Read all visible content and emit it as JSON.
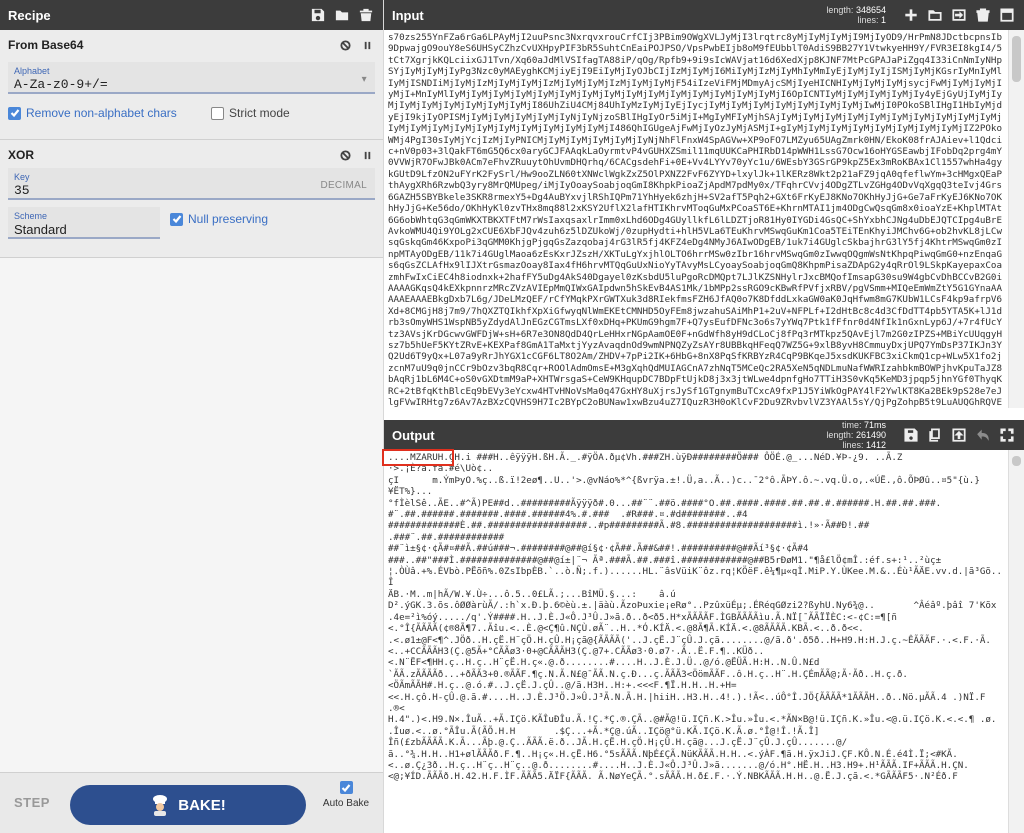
{
  "recipe": {
    "title": "Recipe",
    "operations": [
      {
        "name": "From Base64",
        "alphabet_label": "Alphabet",
        "alphabet_value": "A-Za-z0-9+/=",
        "remove_label": "Remove non-alphabet chars",
        "strict_label": "Strict mode"
      },
      {
        "name": "XOR",
        "key_label": "Key",
        "key_value": "35",
        "key_format": "DECIMAL",
        "scheme_label": "Scheme",
        "scheme_value": "Standard",
        "null_label": "Null preserving"
      }
    ],
    "step_label": "STEP",
    "bake_label": "BAKE!",
    "autobake_label": "Auto Bake"
  },
  "input": {
    "title": "Input",
    "length_label": "length:",
    "length_value": "348654",
    "lines_label": "lines:",
    "lines_value": "1",
    "text": "s70zs255YnFZa6rGa6LPAyMjI2uuPsnc3NxrqvxrouCrfCIj3PBim9OWgXVLJyMjI3lrqtrc8yMjIyMjIyMjI9MjIyOD9/HrPmN8JDctbcpnsIb9DpwajgO9ouY8eS6UHSyCZhzCvUXHpyPIF3bR5SuhtCnEaiPOJPSO/VpsPwbEIjb8oM9fEUbblT0AdiS9BB27Y1VtwkyeHH9Y/FVR3EI8kgI4/5tCt7XgrjkKQLciixGJ1Tvn/Xq60aJdMlVSIfagTA88iP/qOg/Rpfb9+9i9sIcWAVjat16d6XedXjp8KJNF7MtPcGPAJaPiZgq4I33iCnNmIyNHpSYjIyMjIyMjIyPg3Nzc0yMAEyghKCMjiyEjI9EiIyMjIyOJbCIjIzMjIyMjI6MiIyMjIzMjIyMhIyMmIyEjIyMjIyIjISMjIyMjKGsrIyMnIyMlIyMjISNDIiMjIyMjIzMjIyMjIyMjIzMjIyMjIyMjIzMjIyMjIyMjF54iIzeViFMjMDmyAjcSMjIyeHICNHIyMjIyMjIyMjsycjFwMjIyMjIyMjIyMjI+MnIyMlIyMjIyMjIyMjIyMjIyMjIyMjIyMjIyMjIyMjIyMjIyMjIyMjIyMjIyMjIyMjI6OpICNTIyMjIyMjIyMjIyMjIy4yEjGyUjIyMjIyMjIyMjIyMjIyMjIyMjIyMjIyMjI86UhZiU4CMj84UhIyMzIyMjIyEjIycjIyMjIyMjIyMjIyMjIyMjIyMjIyMjIwMjI0POkoSBlIHgI1HbIyMjdyEjI9kjIyOPISMjIyMjIyMjIyMjIyMjIyNjIyNjzoSBlIHgIyOr5iMjI+MgIyMFIyMjhSAjIyMjIyMjIyMjIyMjIyMjIyMjIyMjIyMjIyMjIyMjIyMjIyMjIyMjIyMjIyMjIyMjIyMjIyMjIyMjIyMjI486QhIGUgeAjFwMjIyOzJyMjASMjI+gIyMjIyMjIyMjIyMjIyMjIyMjIyMjIyMjIZ2POkoWMj4PgI30sIyMjYcjIzMjIyPNICMjIyMjIyMjIyMjIyMjIyNjNhFlFnxW4SpAGVw+XP9oFO7LMZyu65UAgZmrk0HN/EkoK08frAJAiev+l1Qdcic+nV0p03+3lQakFT6mG5Q6cx0aryGCJFAAqkLaOyrmtvP4vGUHXZSmil11mqUUKCaPHIRbD14pWWH1LssG7Ocw16oHYGSEawbjIFobDq2prg4mY0VVWjR7OFwJBk0ACm7eFhvZRuuytOhUvmDHQrhq/6CACgsdehFi+0E+Vv4LYYv70yYc1u/6WEsbY3GSrGP9kpZ5Ex3mRoKBAx1Cl1557whHa4gykGUtD9LfzON2uFYrK2FySrl/Hw9ooZLN60tXNWclWgkZxZ5OlPXNZ2FvF6ZYYD+lxylJk+1lKERz8Wkt2p21aFZ9jqA0qfeflwYm+3cHMgxQEaPthAygXRh6RzwbQ3yry8MrQMUpeg/iMjIyOoaySoabjoqGmI8KhpkPioaZjApdM7pdMy0x/TFqhrCVvj4ODgZTLvZGHg4ODvVqXgqQ3teIvj4Grs6GAZH5SBYBkele3SKR8rmexY5+Dg4AuBYxvjlRShIQPm71YhHyek6zhjH+SV2afT5Pqh2+GXt6FrKyEJ8KNo7OKhHyJjG+Ge7aFrKyEJ6KNo7OKhHyJjG+Ke56do/OKhHyKl0zvTHx8mq88l2xKSY2UflX2lafHTIKhrvMToqGuMxPCoaST6E+KhrnMTAI1jm4ODgCwQsqGm8x0ioaYzE+KhplMTAt6G6obWhtqG3qGmWKXTBKXTFtM7rWsIaxqsaxlrImm0xLhd6ODg4GUyllkfL6lLDZTjoR81Hy0IYGDi4GsQC+ShYxbhCJNg4uDbEJQTCIpg4uBrEAvkoWMU4Qi9YOLg2xCUE6XbFJQv4zuh6z5lDZUkoWj/0zupHydti+hlH5VLa6TEuKhrvMSwqGuKm1Coa5TEiTEnKhyiJMChv6G+ob2hvKL8jLCwsqGskqGm46KxpoPi3qGMM0KhjgPjgqGsZazqobaj4rG3lR5fj4KFZ4eDg4NMyJ6AIwODgEB/1uk7i4GUglcSkbajhrG3lY5fj4KhtrMSwqGm0zInpMTAyODgEB/11k7i4GUglMaoa6zEsKxrJZszH/XKTuLgYxjhlOLTO6hrrMSw0zIbr16hrvMSwqGm0zIwwqOQgmWsNtKhpqPiwqGmG0+nzEnqaGs6qGsZCLAfHx9lIJXtrGsmazOoay8Iax4fH6hrvMTQqGuUxNioYyTAvyMsLCyoaySoabjoqGmQ8KhpmPisaZDApG2y4qRrOl9LSkpKayepaxCoazmhFwIxCiEC4h8iodnxk+2hafFY5uDg4AkS40Dgayel0zKsbdU5luPgoRcDMQpt7LJlKZSNHylrJxcBMQofImsapG30su9W4gbCvDhBCCvB2G0iAAAAGKqsQ4kEXkpnnrzMRcZVzAVIEpMmQIWxGAIpdwn5hSkEvB4AS1Mk/1bMPp2ssRGO9cKBwRfPVfjxRBV/pgVSmm+MIQeEmWmZtY5G1GYnaAAAAAEAAAEBkgDxb7L6g/JDeLMzQEF/rCfYMqkPXrGWTXuk3d8RIekfmsFZH6JfAQ0o7K8DfddLxkaGW0aK0JqHfwm8mG7KUbW1LCsF4kp9afrpV6Xd+8CMGjH8j7m9/7hQXZTQIkhfXpXiGfwyqNlWmEKEtCMNHD5OyFEm8jwzahuSAiMhP1+2uV+NFPLf+I2dHtBc8c4d3CfDdTT4pb5YTA5K+lJ1drb3sOmyWHS1WspNB5yZdydAlJnEGzCGTmsLXf0xDHq+PKUmG9hgm7F+Q7ysEufDFNc3o6s7yYWq7Ptk1fFfnr0d4NfIk1nGxnLyp6J/+7r4fUcYtz3AVsjKrDGcwvGWFDjW+sH+6R7e3ON8QdD4QrLeHHxrNGpAamOE0F+nGdWfh8yH9dCLoCj8fPq3rMTkpz5QAvEjl7m2G0zIPZS+MBiYcUUqgyHsz7b5hUeF5KYtZRvE+KEXPaf8GmA1TaMxtjYyzAvaqdnOd9wmNPNQZyZsAYr8UBBkqHFeqQ7WZ5G+9xlB8yvH8CmmuyDxjUPQ7YmDsP37IKJn3YQ2Ud6T9yQx+L07a9yRrJhYGX1cCGF6LT8O2Am/ZHDV+7pPi2IK+6HbG+8nX8PqSfKRBYzR4CqP9BKqeJ5xsdKUKFBC3xiCkmQ1cp+WLw5X1fo2jzcnM7uU9q0jnCCr9bOzv3bqR8Cqr+ROOlAdmOmsE+M3gXqhQdMUIAGCnA7zhNqT5MCeQc2RA5XeN5qNDLmuNafWWRIzahbkmBOWPjhvKpuTaJZ8bAqRj1bL6M4C+oS0vGXDtmM9aP+XHTWrsgaS+CeW9KHqupDC7BDpFtUjkD8j3x3jtWLwe4dpnfgHo7TTiH3S0vKq5KeMD3jpqp5jhnYGf0ThyqKRC+2tBfqKthBlcEq9bEVy3eYcxw4HTvHNoVsMa0q47GxHY8uXjrsJySf1GTgnymBuTCxcA9fxP1J5YiWkOgPAY4lF2YwlKT8Ka2BEk9pS28e7eJlgFVwIRHtg7z6Av7AzBXzCQVHS9H7Ic2BYpC2oBUNaw1xwBzu4uZ7IQuzR3H0oKlCvF2Du9ZRvbvlVZ3YAAl5sY/QjPgZohpB5t9LuAUQGhRQVEF5B3s9+LfXVxIsQjYwQ+vMKP5EqKeE7TStv0WkE2qC1T+UHRv6HdhpfNR2aWu1JCVSh+QIAiRCbUdR7M3XVLWTxKSL7Cxiwu1JkNqmDwvyEaeTqCr/7pvKbFcw9sX+F47L1YDe1CZM0JSL8CmrGjEeJ3sqwm5iRjsJwJbzZHCoCy"
  },
  "output": {
    "title": "Output",
    "time_label": "time:",
    "time_value": "71ms",
    "length_label": "length:",
    "length_value": "261490",
    "lines_label": "lines:",
    "lines_value": "1412",
    "text": "....MZARUH.ÇH.i ###H..êÿÿÿH.ßH.Ã._.#ÿÖA.ðµ¢Vh.###ZH.ùÿÐ########Ö### ÔÖÉ.@_...NéD.¥Þ-¿9. ..Ã.Z\n·>.¡È?ã.fã.#é\\Uò¢..\nçI      m.ÝmÞyO.%ç..ß.ï!2eø¶..U..'>.@vNáo%*^{ßvrÿa.±!.Ü,a..Ã..)c..¯2°ô.ÃÞY.ô.~.vq.Ü.o,.«ÚË.,ô.ÕÞØû..¤5\"{ù.}\n¥ËT%}...\n°fÌèlSê..ÃE..#^Ã)PE##d..#########Ãÿÿÿð#.0...##¨¨.##ö.####°O.##.####.####.##.##.#.######.H.##.##.###.\n#¨.##.######.#######.####.######4%.#.###  .#R###.¤.#d########..#4\n#############È.##.##################..#p#########Ã.#8.####################ì.!»·Ã##Ð!.##\n.###¨.##.############\n##¨ì±§¢·¢Ã#¤##Ã.##ú###¬.########@##@í§¢·¢Ã##.Ã##&##!.##########@##Ãí³§¢·¢Ã#4\n###..##\"###Ì.##############@##@í±|¨¬ Ãª.###Ã.##.###î.############@##B5rÐøM1.\"¶å£lÖ¢mÎ.:éf.s+:¹..²ùç±\n¦.ÒÙâ.+%.ÉVbò.PËõñ%.0ZsIbpÈB.`..ò.Ñ;.f.)......HL.¨âsVüiK¨ôz.rq¦KÖëF.ê¼¶µ«qÌ.MiP.Y.ÙKee.M.&..Éù¹ÃÄE.vv.d.|ã³Gõ..Î\nÄB.·M..m|hÃ/W.¥.Ù÷...ô.5..0£LÃ.;...BîMÜ.§...:    â.ú\nD².ýGK.3.õs.ôØØàrùÃ/.:h`x.Ð.þ.6©èù.±.|äàù.ÃzoÞuxie¡eRø°..PzûxüÉµ;.ÉRéqGØzi2?ßyhU.Ny6¾@..       ^Âéâº.þâî 7'Kõx\n.4e=²ì%óý...../q'.Ý####.H..J.È.J«Ô.J³Û.J»ã.ð..ð<ð5.H*xÃÃÃÃF.ÌGBÃÃÃÃìu.Ã.NÏ[¯ÃÃÏÏÈC:<-¢C:=¶[ñ\n<.°Î{ÃÃÃÃ(¢®8Ã¶7..Ãîu.<..È.@<Ç¶û.NÇÙ.øÃ¨..H..*Ó.KÍÄ.<.@8Ã¶Ã.KÍÄ.<.@8ÃÃÃÃ.KBÃ.<..ð.ð<<.\n.<.ø1±@F<¶^.JÖð..H.çË.H¨çÖ.H.çÛ.H¡çã@{ÃÃÃÃ('..J.çË.J¨çÛ.J.çã........@/ã.ð'.ð5ð..H+H9.H:H.J.ç.~ÊÃÃÃF.·.<.F.·Ã.\n<..+CCÃÃÃH3(Ç.@5Ã+°CÃÃø3·0+@CÃÃÃH3(Ç.@7+.CÃÃø3·0.ø7·.Ã..Ë.F.¶..KÜð..\n<.N¨ËF<¶HH.ç..H.ç..H¨çË.H.ç«.@.ð........#....H..J.È.J.Ü..@/ó.@ËÜÃ.H:H..N.Û.N£d\n`ÃÃ.zÃÃÃÃð...+ðÃÃ3+0.®ÃÃF.¶ç.N.Ã.N£@¯ÃÃ.N.ç.Ð...ç.ÃÃÃ3<ÖömÃÃF..ô.H.ç..H¨.H.ÇÉmÃÃ@;Ã·Ãð..H.ç.ð.\n<ÖÃmÃÃH#.H.ç..@.ó.#..J.çË.J.çÛ..@/ã.H3H..H:+.<<<F.¶Ï.H.H..H.+H=\n<<.H.çô.H-çÛ.@.ã.#....H..J.È.J³Ö.J»Û.J³Ã.N.Ã.H.|hiiH..H3.H..4!.).!Ã<..úÔ°Î.JÖ{ÃÃÃÃ*1ÃÃÃH..ð..Nö.µÃÃ.4 .)NÏ.F\n.®<\nH.4\".)<.H9.N×.ÎuÃ..+Ã.IÇö.KÃÎuÐÎu.Ã.!Ç.*Ç.®.ÇÃ..@#Ã@!ü.IÇñ.K.>Îu.»Îu.<.*ÃN×B@!ü.IÇñ.K.»Îu.<@.ü.IÇö.K.<.<.¶ .ø.\n.Îuø.<..ø.°ÃÎu.Ã(ÃÕ.H.H       .$Ç...+Ã.*Ç@.úÃ..IÇö@°ü.KÃ.IÇö.K.Ã.ø.°Î@!Î.!Ã.Î]\nÎñ(£zbÃÃÃÃ.K.Ã...Ãþ.@.Ç..ÃÃÃ.ë.ð..JÃ.H.çË.H.çÖ.H¡çÛ.H.çã@...J.çË.J¨çÛ.J.çÛ.......@/\nã..°¾.H.H..H1+ølÃÃÃð.F.¶..H¡ç«.H.çË.H6.°5sÃÃÃ.NþÉ£ÇÃ.NüKÃÃÃ.H.H..<.ýÀF.¶ã.H.ÿxJiJ.ÇF.KÔ.N.É.é4Ì.Ï;<#KÃ.\n<..ø.Ç¿3ð..H.ç..H¨ç..H¨ç..@.ð........#....H..J.È.J«Ô.J³Û.J»ã.......@/ó.H°.HË.H..H3.H9+.H¹ÃÃÃ.IF+ÃÃÃ.H.ÇN.\n<@;¥ÍD.ÃÃÃð.H.42.H.F.ÌF.ÃÃÃ5.ÄÏF{ÃÃÃ. Ã.NøYeÇÃ.°.sÃÃÃ.H.ð£.F.·.Ý.NBKÃÃÃ.H.H..@.Ë.J.çã.<.*GÃÃÃF5·.N²Éð.F"
  }
}
